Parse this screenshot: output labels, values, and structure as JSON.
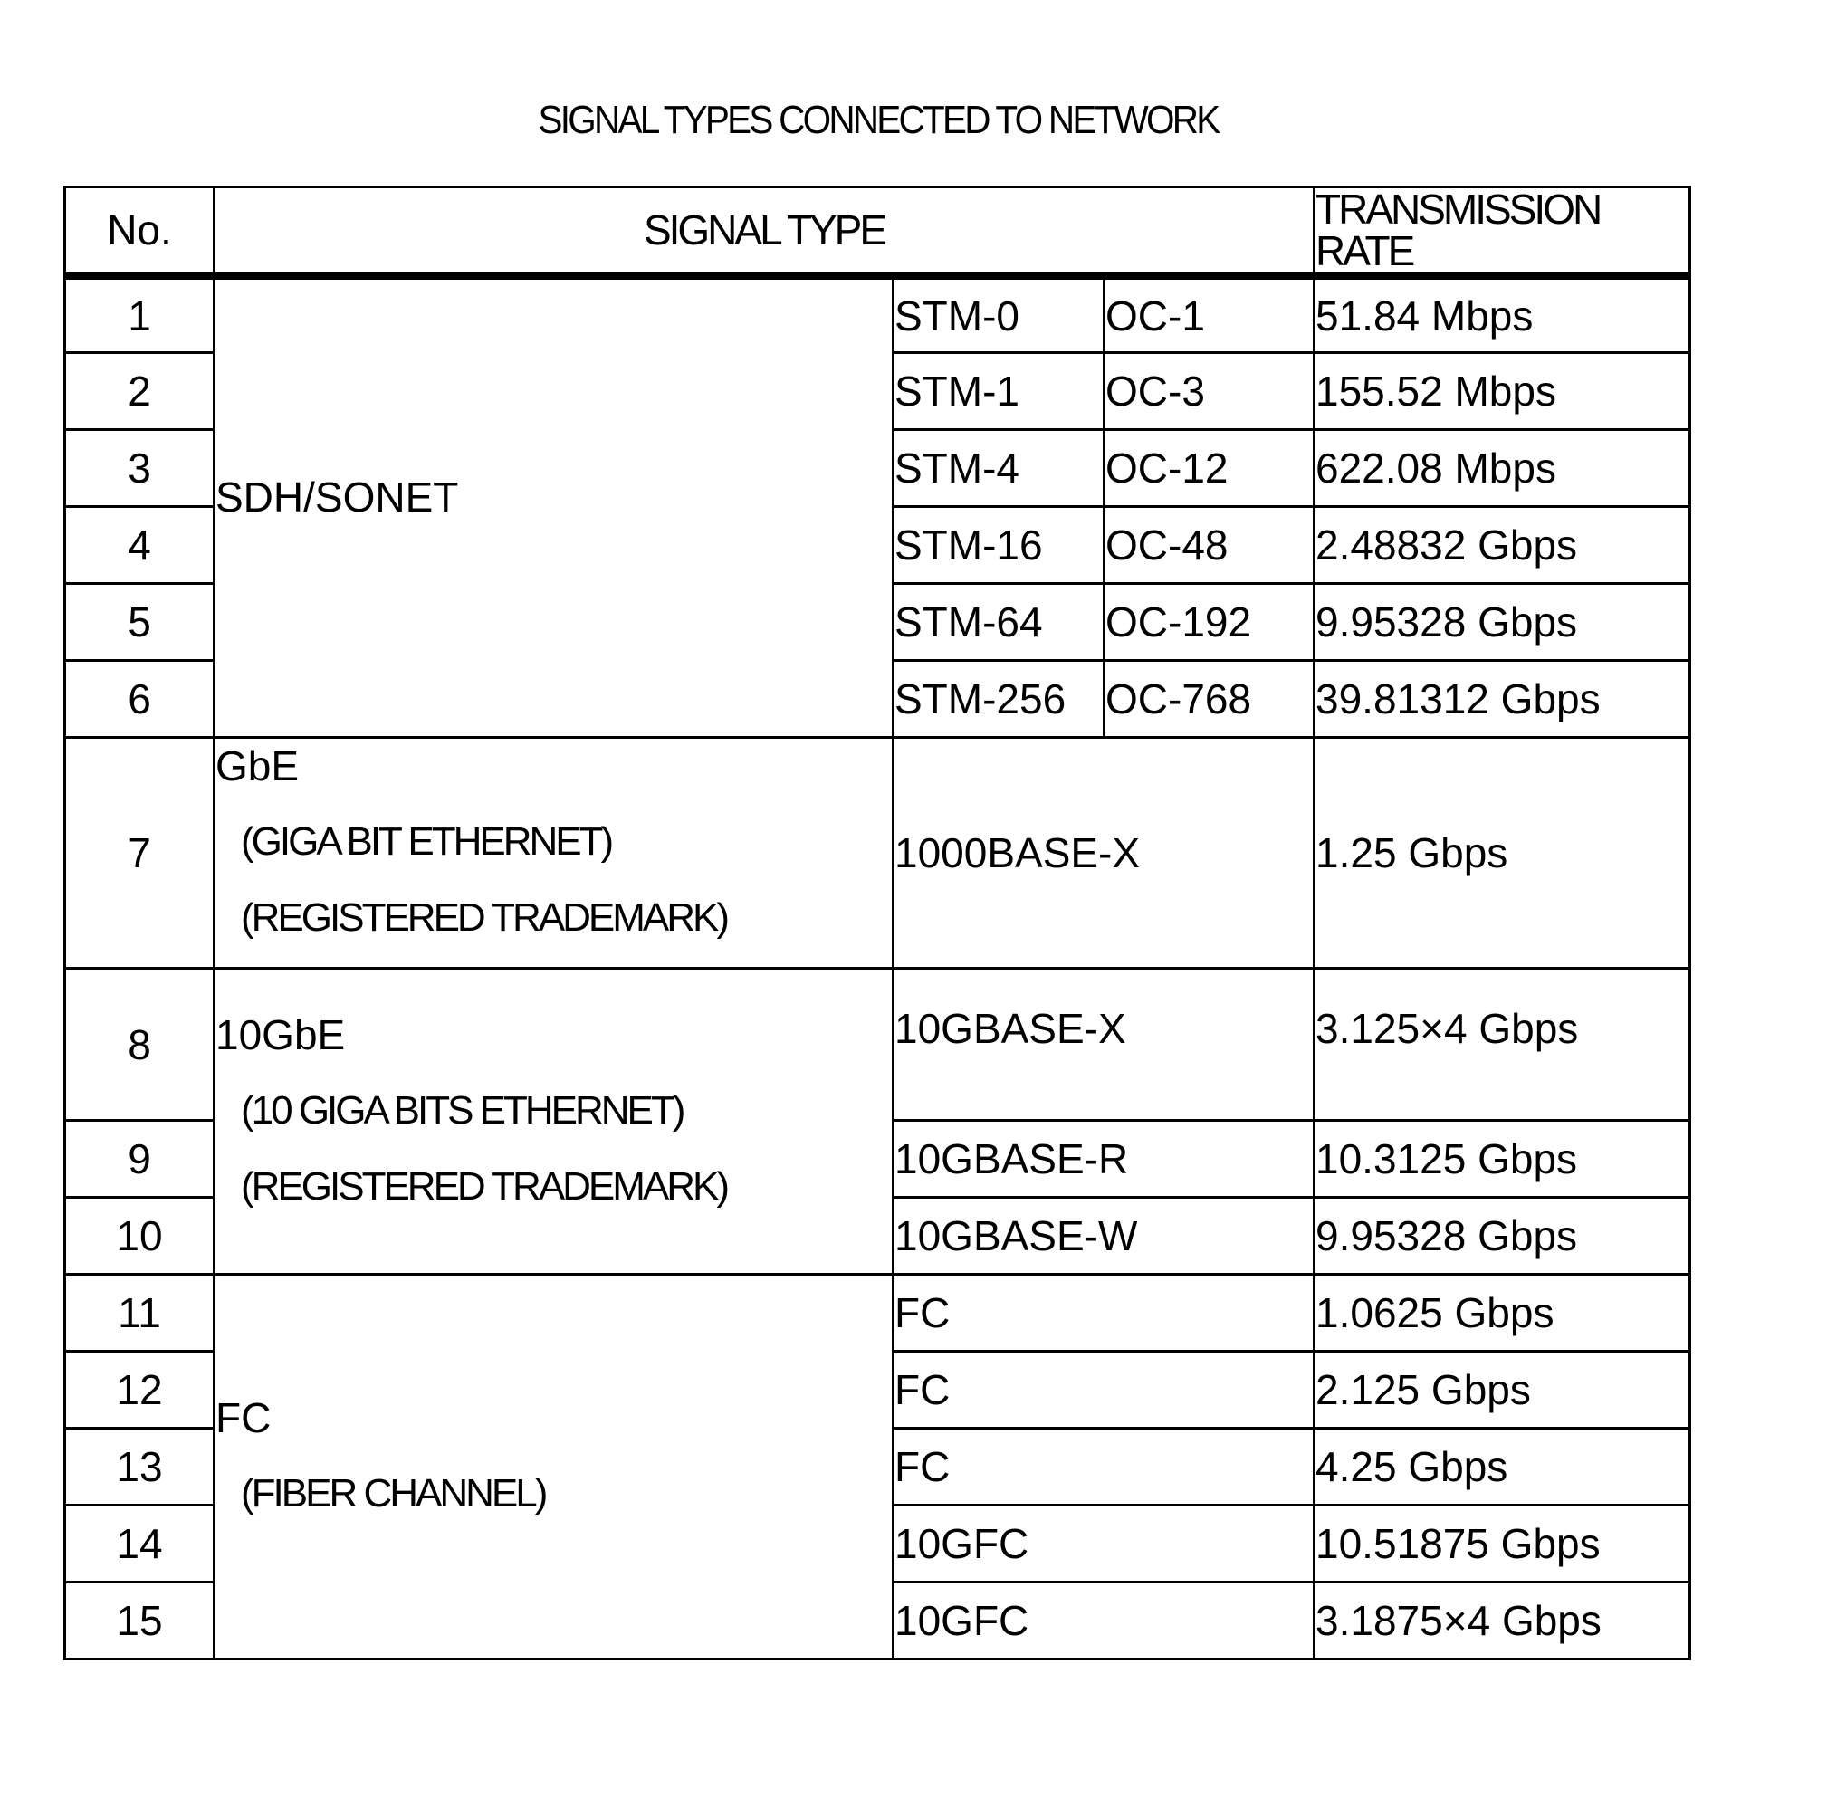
{
  "title": "SIGNAL TYPES CONNECTED TO NETWORK",
  "headers": {
    "no": "No.",
    "signal_type": "SIGNAL TYPE",
    "transmission_rate": "TRANSMISSION RATE"
  },
  "groups": {
    "sdh": {
      "name": "SDH/SONET"
    },
    "gbe": {
      "name": "GbE",
      "sub1": "(GIGA BIT ETHERNET)",
      "sub2": "(REGISTERED TRADEMARK)"
    },
    "tengbe": {
      "name": "10GbE",
      "sub1": "(10 GIGA BITS ETHERNET)",
      "sub2": "(REGISTERED TRADEMARK)"
    },
    "fc": {
      "name": "FC",
      "sub1": "(FIBER CHANNEL)"
    }
  },
  "rows": [
    {
      "no": "1",
      "type_a": "STM-0",
      "type_b": "OC-1",
      "rate": "51.84 Mbps"
    },
    {
      "no": "2",
      "type_a": "STM-1",
      "type_b": "OC-3",
      "rate": "155.52 Mbps"
    },
    {
      "no": "3",
      "type_a": "STM-4",
      "type_b": "OC-12",
      "rate": "622.08 Mbps"
    },
    {
      "no": "4",
      "type_a": "STM-16",
      "type_b": "OC-48",
      "rate": "2.48832 Gbps"
    },
    {
      "no": "5",
      "type_a": "STM-64",
      "type_b": "OC-192",
      "rate": "9.95328 Gbps"
    },
    {
      "no": "6",
      "type_a": "STM-256",
      "type_b": "OC-768",
      "rate": "39.81312 Gbps"
    },
    {
      "no": "7",
      "type_a": "1000BASE-X",
      "rate": "1.25 Gbps"
    },
    {
      "no": "8",
      "type_a": "10GBASE-X",
      "rate": "3.125×4 Gbps"
    },
    {
      "no": "9",
      "type_a": "10GBASE-R",
      "rate": "10.3125 Gbps"
    },
    {
      "no": "10",
      "type_a": "10GBASE-W",
      "rate": "9.95328 Gbps"
    },
    {
      "no": "11",
      "type_a": "FC",
      "rate": "1.0625 Gbps"
    },
    {
      "no": "12",
      "type_a": "FC",
      "rate": "2.125 Gbps"
    },
    {
      "no": "13",
      "type_a": "FC",
      "rate": "4.25 Gbps"
    },
    {
      "no": "14",
      "type_a": "10GFC",
      "rate": "10.51875 Gbps"
    },
    {
      "no": "15",
      "type_a": "10GFC",
      "rate": "3.1875×4 Gbps"
    }
  ]
}
